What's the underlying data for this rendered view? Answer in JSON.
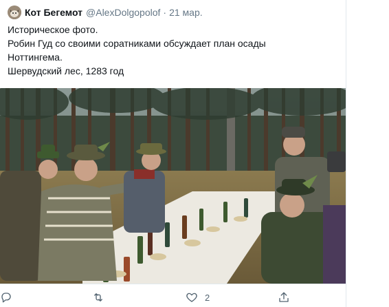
{
  "tweet": {
    "author": {
      "display_name": "Кот Бегемот",
      "handle": "@AlexDolgopolof",
      "avatar_icon": "cat-avatar"
    },
    "separator": "·",
    "date": "21 мар.",
    "text_lines": [
      "Историческое фото.",
      "Робин Гуд со своими соратниками обсуждает план осады",
      "Ноттингема.",
      "Шервудский лес, 1283 год"
    ],
    "photo": {
      "scene": "men in hunting hats around a long outdoor table in a pine forest"
    },
    "actions": {
      "reply": {
        "icon": "reply-icon",
        "count": ""
      },
      "retweet": {
        "icon": "retweet-icon",
        "count": ""
      },
      "like": {
        "icon": "heart-icon",
        "count": "2"
      },
      "share": {
        "icon": "share-icon",
        "count": ""
      }
    }
  },
  "colors": {
    "text": "#0f1419",
    "secondary_text": "#657786",
    "icon": "#536471",
    "border": "#e1e8ed"
  }
}
